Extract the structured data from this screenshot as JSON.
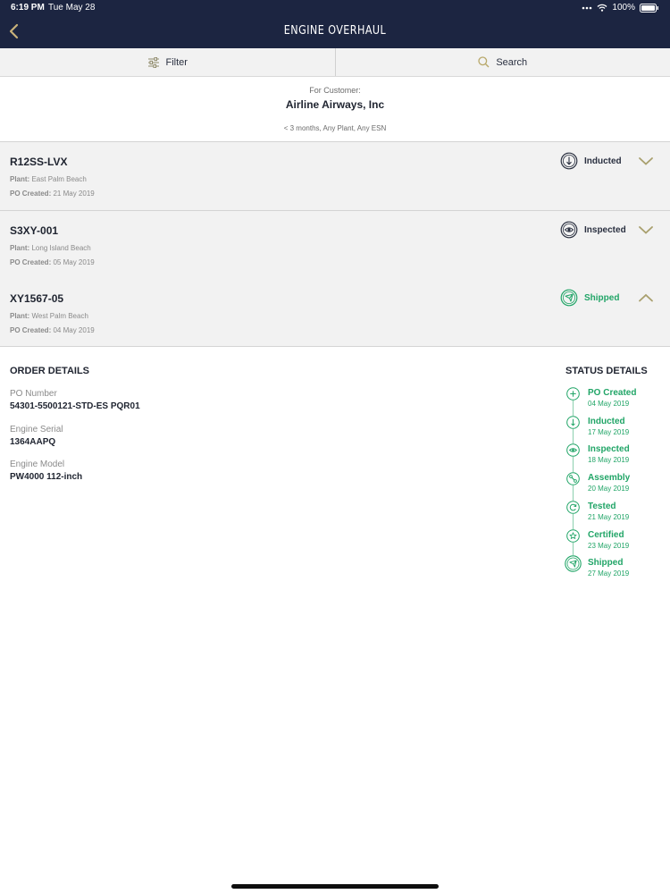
{
  "status_bar": {
    "time": "6:19 PM",
    "date": "Tue May 28",
    "battery": "100%"
  },
  "nav": {
    "title": "ENGINE OVERHAUL"
  },
  "toolbar": {
    "filter_label": "Filter",
    "search_label": "Search"
  },
  "customer": {
    "label": "For Customer:",
    "name": "Airline Airways, Inc",
    "filter_summary": "< 3 months, Any Plant, Any ESN"
  },
  "orders": [
    {
      "id": "R12SS-LVX",
      "plant_label": "Plant:",
      "plant": "East Palm Beach",
      "po_label": "PO Created:",
      "po_created": "21 May 2019",
      "status": "Inducted",
      "status_icon": "arrow-down-circle-icon",
      "expanded": false
    },
    {
      "id": "S3XY-001",
      "plant_label": "Plant:",
      "plant": "Long Island Beach",
      "po_label": "PO Created:",
      "po_created": "05 May 2019",
      "status": "Inspected",
      "status_icon": "eye-circle-icon",
      "expanded": false
    },
    {
      "id": "XY1567-05",
      "plant_label": "Plant:",
      "plant": "West Palm Beach",
      "po_label": "PO Created:",
      "po_created": "04 May 2019",
      "status": "Shipped",
      "status_icon": "plane-circle-icon",
      "expanded": true
    }
  ],
  "order_details": {
    "title": "ORDER DETAILS",
    "po_number_label": "PO Number",
    "po_number": "54301-5500121-STD-ES PQR01",
    "engine_serial_label": "Engine Serial",
    "engine_serial": "1364AAPQ",
    "engine_model_label": "Engine Model",
    "engine_model": "PW4000 112-inch"
  },
  "status_details": {
    "title": "STATUS DETAILS",
    "steps": [
      {
        "name": "PO Created",
        "date": "04 May 2019",
        "icon": "plus-circle-icon"
      },
      {
        "name": "Inducted",
        "date": "17 May 2019",
        "icon": "arrow-down-circle-icon"
      },
      {
        "name": "Inspected",
        "date": "18 May 2019",
        "icon": "eye-circle-icon"
      },
      {
        "name": "Assembly",
        "date": "20 May 2019",
        "icon": "wrench-circle-icon"
      },
      {
        "name": "Tested",
        "date": "21 May 2019",
        "icon": "refresh-circle-icon"
      },
      {
        "name": "Certified",
        "date": "23 May 2019",
        "icon": "star-circle-icon"
      },
      {
        "name": "Shipped",
        "date": "27 May 2019",
        "icon": "plane-circle-icon"
      }
    ]
  },
  "colors": {
    "navy": "#1c2541",
    "green": "#21a567",
    "accent_gold": "#b8a86a",
    "row_bg": "#f2f2f2"
  }
}
